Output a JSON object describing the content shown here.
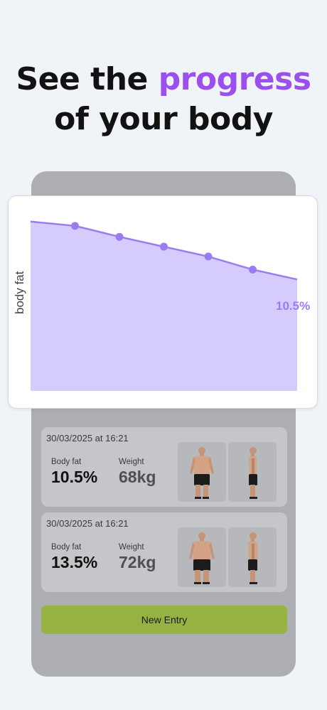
{
  "headline": {
    "before": "See the ",
    "accent": "progress",
    "after": " of your body",
    "accent_color": "#9b50ee"
  },
  "chart_data": {
    "type": "area",
    "ylabel": "body fat",
    "xlabel": "",
    "title": "",
    "color": "#9b7cf0",
    "fill": "#d5ccfd",
    "x": [
      0,
      1,
      2,
      3,
      4,
      5,
      6
    ],
    "points": [
      {
        "x": 0,
        "y": 15.5
      },
      {
        "x": 1,
        "y": 15.1
      },
      {
        "x": 2,
        "y": 14.1
      },
      {
        "x": 3,
        "y": 13.2
      },
      {
        "x": 4,
        "y": 12.3
      },
      {
        "x": 5,
        "y": 11.1
      },
      {
        "x": 6,
        "y": 10.2
      }
    ],
    "marked_points": [
      1,
      2,
      3,
      4,
      5
    ],
    "last_label": "10.5%",
    "ylim": [
      0,
      16
    ],
    "grid": false
  },
  "entries": [
    {
      "date": "30/03/2025 at 16:21",
      "fat_label": "Body fat",
      "fat_value": "10.5%",
      "weight_label": "Weight",
      "weight_value": "68kg"
    },
    {
      "date": "30/03/2025 at 16:21",
      "fat_label": "Body fat",
      "fat_value": "13.5%",
      "weight_label": "Weight",
      "weight_value": "72kg"
    }
  ],
  "new_entry_button": "New Entry"
}
